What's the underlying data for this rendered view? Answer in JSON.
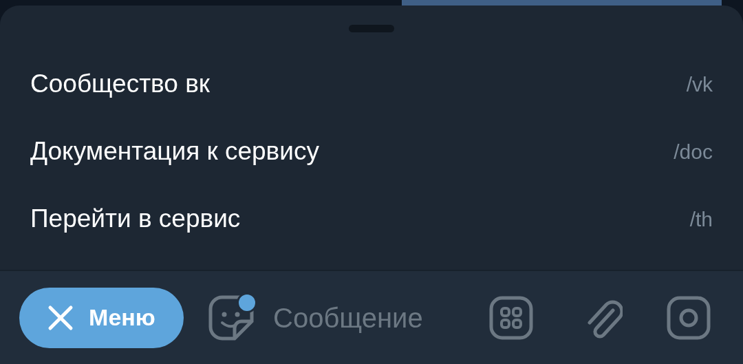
{
  "commands": [
    {
      "label": "Сообщество вк",
      "command": "/vk"
    },
    {
      "label": "Документация к сервису",
      "command": "/doc"
    },
    {
      "label": "Перейти в сервис",
      "command": "/th"
    }
  ],
  "composer": {
    "menu_button": "Меню",
    "placeholder": "Сообщение",
    "sticker_badge": true
  }
}
